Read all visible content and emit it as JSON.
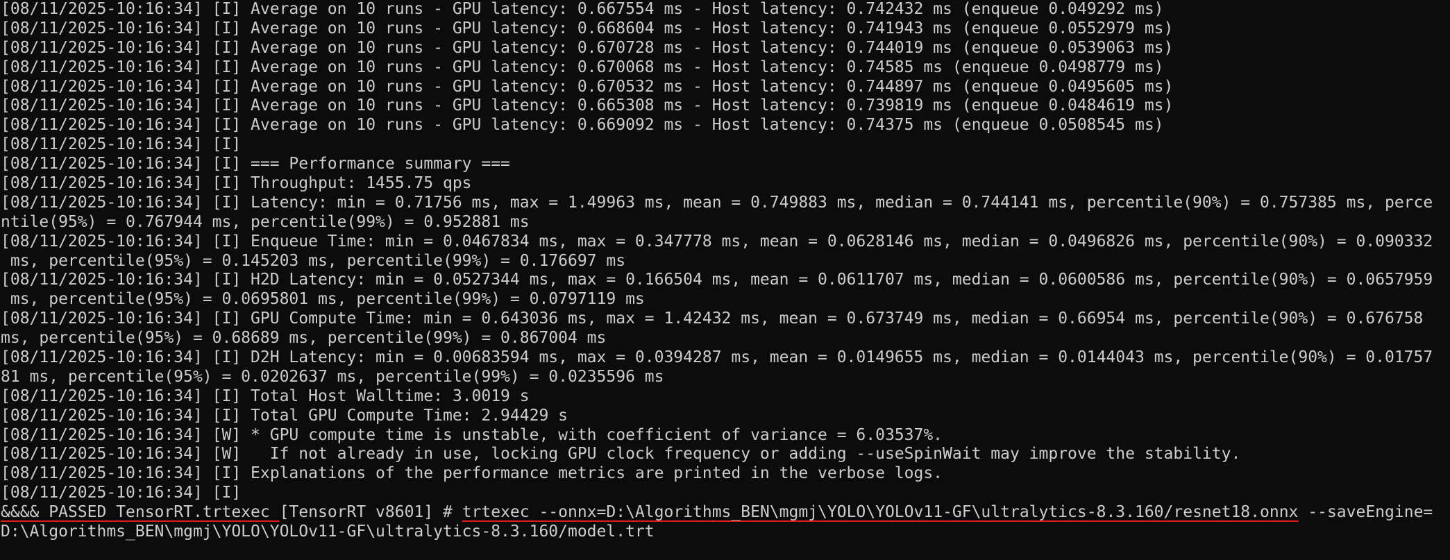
{
  "terminal": {
    "lines": [
      "[08/11/2025-10:16:34] [I] Average on 10 runs - GPU latency: 0.667554 ms - Host latency: 0.742432 ms (enqueue 0.049292 ms)",
      "[08/11/2025-10:16:34] [I] Average on 10 runs - GPU latency: 0.668604 ms - Host latency: 0.741943 ms (enqueue 0.0552979 ms)",
      "[08/11/2025-10:16:34] [I] Average on 10 runs - GPU latency: 0.670728 ms - Host latency: 0.744019 ms (enqueue 0.0539063 ms)",
      "[08/11/2025-10:16:34] [I] Average on 10 runs - GPU latency: 0.670068 ms - Host latency: 0.74585 ms (enqueue 0.0498779 ms)",
      "[08/11/2025-10:16:34] [I] Average on 10 runs - GPU latency: 0.670532 ms - Host latency: 0.744897 ms (enqueue 0.0495605 ms)",
      "[08/11/2025-10:16:34] [I] Average on 10 runs - GPU latency: 0.665308 ms - Host latency: 0.739819 ms (enqueue 0.0484619 ms)",
      "[08/11/2025-10:16:34] [I] Average on 10 runs - GPU latency: 0.669092 ms - Host latency: 0.74375 ms (enqueue 0.0508545 ms)",
      "[08/11/2025-10:16:34] [I]",
      "[08/11/2025-10:16:34] [I] === Performance summary ===",
      "[08/11/2025-10:16:34] [I] Throughput: 1455.75 qps",
      "[08/11/2025-10:16:34] [I] Latency: min = 0.71756 ms, max = 1.49963 ms, mean = 0.749883 ms, median = 0.744141 ms, percentile(90%) = 0.757385 ms, perce",
      "ntile(95%) = 0.767944 ms, percentile(99%) = 0.952881 ms",
      "[08/11/2025-10:16:34] [I] Enqueue Time: min = 0.0467834 ms, max = 0.347778 ms, mean = 0.0628146 ms, median = 0.0496826 ms, percentile(90%) = 0.090332",
      " ms, percentile(95%) = 0.145203 ms, percentile(99%) = 0.176697 ms",
      "[08/11/2025-10:16:34] [I] H2D Latency: min = 0.0527344 ms, max = 0.166504 ms, mean = 0.0611707 ms, median = 0.0600586 ms, percentile(90%) = 0.0657959",
      " ms, percentile(95%) = 0.0695801 ms, percentile(99%) = 0.0797119 ms",
      "[08/11/2025-10:16:34] [I] GPU Compute Time: min = 0.643036 ms, max = 1.42432 ms, mean = 0.673749 ms, median = 0.66954 ms, percentile(90%) = 0.676758",
      "ms, percentile(95%) = 0.68689 ms, percentile(99%) = 0.867004 ms",
      "[08/11/2025-10:16:34] [I] D2H Latency: min = 0.00683594 ms, max = 0.0394287 ms, mean = 0.0149655 ms, median = 0.0144043 ms, percentile(90%) = 0.01757",
      "81 ms, percentile(95%) = 0.0202637 ms, percentile(99%) = 0.0235596 ms",
      "[08/11/2025-10:16:34] [I] Total Host Walltime: 3.0019 s",
      "[08/11/2025-10:16:34] [I] Total GPU Compute Time: 2.94429 s",
      "[08/11/2025-10:16:34] [W] * GPU compute time is unstable, with coefficient of variance = 6.03537%.",
      "[08/11/2025-10:16:34] [W]   If not already in use, locking GPU clock frequency or adding --useSpinWait may improve the stability.",
      "[08/11/2025-10:16:34] [I] Explanations of the performance metrics are printed in the verbose logs.",
      "[08/11/2025-10:16:34] [I]"
    ],
    "passed": {
      "segment_a": "&&&& PASSED TensorRT.trtexec ",
      "segment_b": "[TensorRT v8601] # ",
      "segment_c": "trtexec --onnx=D:\\Algorithms_BEN\\mgmj\\YOLO\\YOLOv11-GF\\ultralytics-8.3.160/resnet18.onnx",
      "segment_d": " --saveEngine="
    },
    "last_line": "D:\\Algorithms_BEN\\mgmj\\YOLO\\YOLOv11-GF\\ultralytics-8.3.160/model.trt",
    "colors": {
      "background": "#0c0c0c",
      "text": "#cccccc",
      "underline": "#e01c1c"
    }
  }
}
